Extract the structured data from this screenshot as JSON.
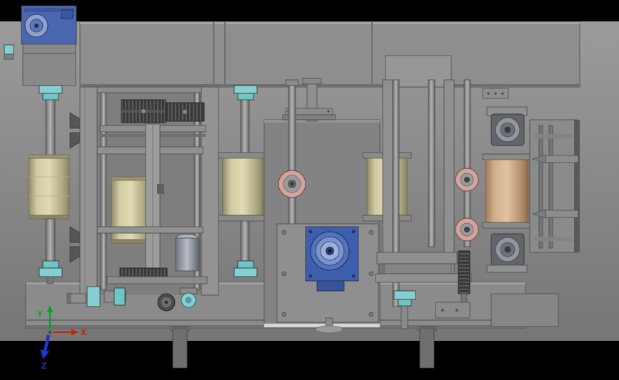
{
  "triad": {
    "x_label": "X",
    "y_label": "Y",
    "z_label": "Z"
  },
  "colors": {
    "background_black": "#000000",
    "viewport_gray_top": "#9b9b9b",
    "viewport_gray_bottom": "#767676",
    "machine_gray": "#8e8e8e",
    "machine_gray_dark": "#6f6f6f",
    "panel_gray": "#838383",
    "roller_tan": "#d3cea6",
    "roller_orange": "#d4b292",
    "bearing_teal": "#84d0d0",
    "bearing_teal_light": "#6fc6c6",
    "motor_blue": "#4a67b0",
    "gearbox_blue": "#3e5fae",
    "ring_pink": "#d2a49e",
    "gear_dark": "#3a3a3a",
    "highlight_strip": "#d9d9d9",
    "axis_x_red": "#cc1f00",
    "axis_y_green": "#00a51f",
    "axis_z_blue": "#1f35cc"
  }
}
